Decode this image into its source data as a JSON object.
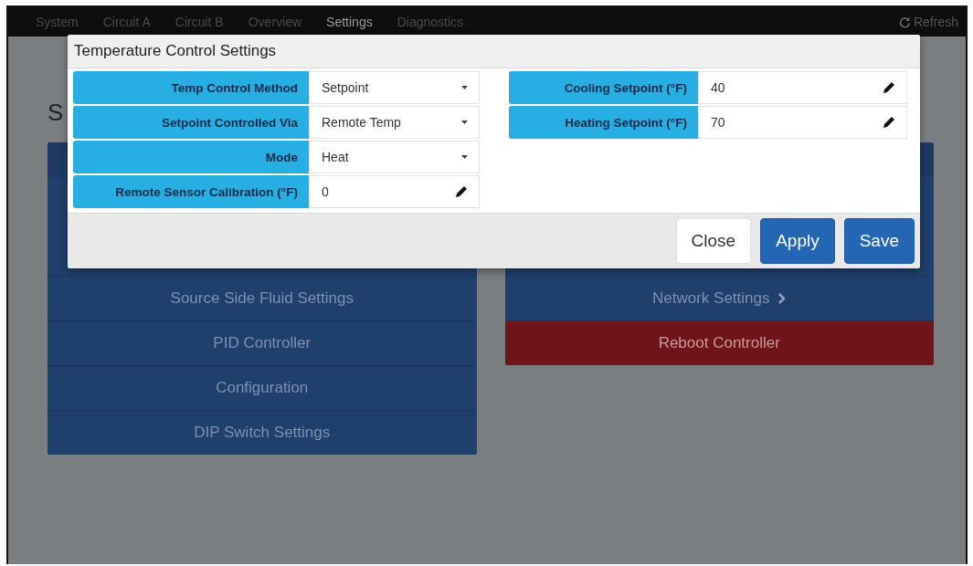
{
  "navbar": {
    "tabs": [
      {
        "label": "System",
        "selected": false
      },
      {
        "label": "Circuit A",
        "selected": false
      },
      {
        "label": "Circuit B",
        "selected": false
      },
      {
        "label": "Overview",
        "selected": false
      },
      {
        "label": "Settings",
        "selected": true
      },
      {
        "label": "Diagnostics",
        "selected": false
      }
    ],
    "refresh": "Refresh"
  },
  "page_title": "S",
  "left_panel": {
    "items": [
      {
        "label": "Source Side Fluid Settings",
        "kind": "nav",
        "chevron": false
      },
      {
        "label": "PID Controller",
        "kind": "nav",
        "chevron": false
      },
      {
        "label": "Configuration",
        "kind": "nav",
        "chevron": false
      },
      {
        "label": "DIP Switch Settings",
        "kind": "nav",
        "chevron": false
      }
    ]
  },
  "right_panel": {
    "items": [
      {
        "label": "Network Settings",
        "kind": "nav",
        "chevron": true
      },
      {
        "label": "Reboot Controller",
        "kind": "danger",
        "chevron": false
      }
    ]
  },
  "modal": {
    "title": "Temperature Control Settings",
    "left_fields": [
      {
        "label": "Temp Control Method",
        "value": "Setpoint",
        "kind": "select"
      },
      {
        "label": "Setpoint Controlled Via",
        "value": "Remote Temp",
        "kind": "select"
      },
      {
        "label": "Mode",
        "value": "Heat",
        "kind": "select"
      },
      {
        "label": "Remote Sensor Calibration (°F)",
        "value": "0",
        "kind": "text"
      }
    ],
    "right_fields": [
      {
        "label": "Cooling Setpoint (°F)",
        "value": "40",
        "kind": "text"
      },
      {
        "label": "Heating Setpoint (°F)",
        "value": "70",
        "kind": "text"
      }
    ],
    "buttons": [
      {
        "label": "Close",
        "kind": "default"
      },
      {
        "label": "Apply",
        "kind": "primary"
      },
      {
        "label": "Save",
        "kind": "primary"
      }
    ]
  }
}
